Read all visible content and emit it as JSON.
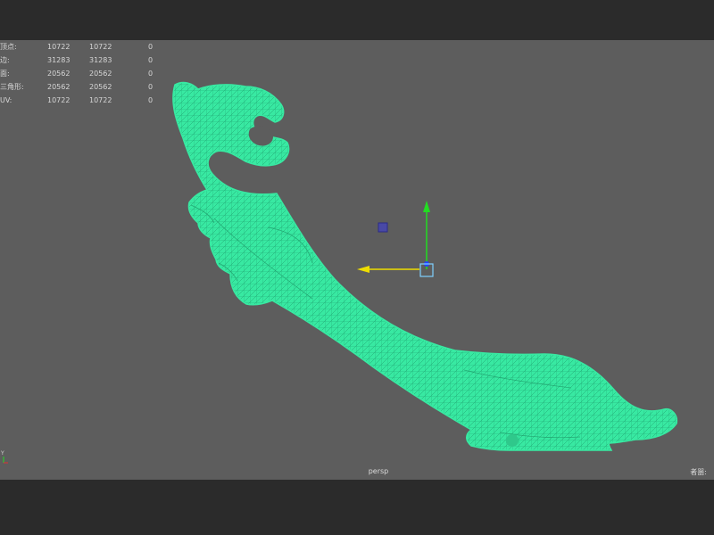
{
  "hud": {
    "rows": [
      {
        "label": "顶点:",
        "v1": "10722",
        "v2": "10722",
        "v3": "0"
      },
      {
        "label": "边:",
        "v1": "31283",
        "v2": "31283",
        "v3": "0"
      },
      {
        "label": "面:",
        "v1": "20562",
        "v2": "20562",
        "v3": "0"
      },
      {
        "label": "三角形:",
        "v1": "20562",
        "v2": "20562",
        "v3": "0"
      },
      {
        "label": "UV:",
        "v1": "10722",
        "v2": "10722",
        "v3": "0"
      }
    ]
  },
  "viewport": {
    "camera_name": "persp",
    "right_label": "者噐:",
    "axis_label": "Y"
  },
  "colors": {
    "mesh": "#38e9a2",
    "wire": "#1f9c6a",
    "y_axis": "#22dd22",
    "x_axis": "#eedd00",
    "z_axis": "#2244ff",
    "viewport_bg": "#5d5d5d"
  },
  "icons": {
    "manipulator": "move-tool-manipulator-icon",
    "axis": "axis-indicator-icon"
  }
}
